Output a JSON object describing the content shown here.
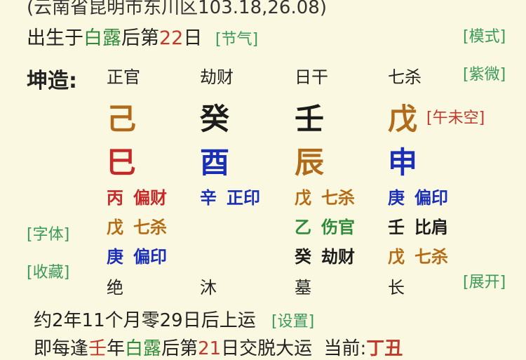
{
  "header": {
    "location": "(云南省昆明市东川区103.18,26.08)",
    "birth_prefix": "出生于",
    "birth_term": "白露",
    "birth_mid": "后第",
    "birth_day": "22",
    "birth_suffix": "日",
    "jieqi_link": "[节气]"
  },
  "side_right": {
    "mode": "[模式]",
    "ziwei": "[紫微]",
    "expand": "[展开]"
  },
  "side_left": {
    "font": "[字体]",
    "favorite": "[收藏]"
  },
  "chart": {
    "label": "坤造:",
    "ten_gods": [
      "正官",
      "劫财",
      "日干",
      "七杀"
    ],
    "stems": [
      "己",
      "癸",
      "壬",
      "戊"
    ],
    "void_note": "[午未空]",
    "branches": [
      "巳",
      "酉",
      "辰",
      "申"
    ],
    "colors": {
      "earth_brown": "#b06a1a",
      "fire_red": "#c62828",
      "water_black": "#1b1b1b",
      "metal_blue": "#1a2fb8",
      "wood_green": "#2e8b3a"
    },
    "hidden": [
      [
        {
          "stem": "丙",
          "god": "偏财"
        },
        {
          "stem": "戊",
          "god": "七杀"
        },
        {
          "stem": "庚",
          "god": "偏印"
        }
      ],
      [
        {
          "stem": "辛",
          "god": "正印"
        }
      ],
      [
        {
          "stem": "戊",
          "god": "七杀"
        },
        {
          "stem": "乙",
          "god": "伤官"
        },
        {
          "stem": "癸",
          "god": "劫财"
        }
      ],
      [
        {
          "stem": "庚",
          "god": "偏印"
        },
        {
          "stem": "壬",
          "god": "比肩"
        },
        {
          "stem": "戊",
          "god": "七杀"
        }
      ]
    ],
    "stages": [
      "绝",
      "沐",
      "墓",
      "长"
    ]
  },
  "luck": {
    "text": "约2年11个月零29日后上运",
    "settings": "[设置]"
  },
  "footer": {
    "p1": "即每逢",
    "p2": "壬",
    "p3": "年",
    "p4": "白露",
    "p5": "后第",
    "p6": "21",
    "p7": "日交脱大运",
    "p8": "当前:",
    "p9": "丁丑"
  }
}
